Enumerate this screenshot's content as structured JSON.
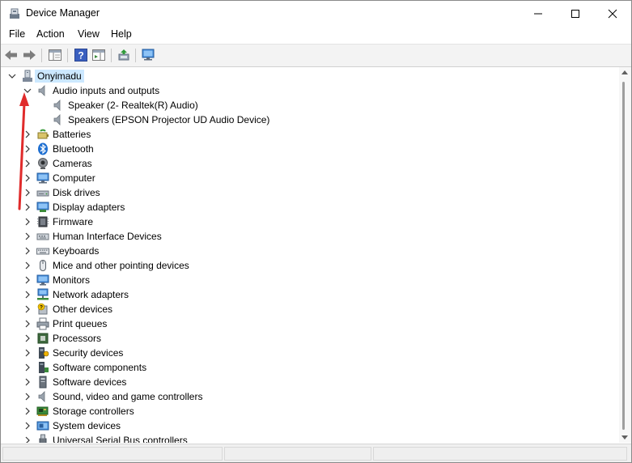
{
  "window": {
    "title": "Device Manager",
    "controls": {
      "minimize": "minimize",
      "maximize": "maximize",
      "close": "close"
    }
  },
  "menu": {
    "items": [
      "File",
      "Action",
      "View",
      "Help"
    ]
  },
  "toolbar": {
    "buttons": [
      "back-icon",
      "forward-icon",
      "properties-pane-icon",
      "help-icon",
      "action-pane-icon",
      "update-driver-icon",
      "scan-hardware-icon"
    ]
  },
  "tree": {
    "root": "Onyimadu",
    "categories": [
      {
        "label": "Audio inputs and outputs",
        "icon": "speaker-icon",
        "expanded": true,
        "children": [
          "Speaker (2- Realtek(R) Audio)",
          "Speakers (EPSON Projector UD Audio Device)"
        ]
      },
      {
        "label": "Batteries",
        "icon": "battery-icon"
      },
      {
        "label": "Bluetooth",
        "icon": "bluetooth-icon"
      },
      {
        "label": "Cameras",
        "icon": "camera-icon"
      },
      {
        "label": "Computer",
        "icon": "computer-icon"
      },
      {
        "label": "Disk drives",
        "icon": "disk-drive-icon"
      },
      {
        "label": "Display adapters",
        "icon": "display-adapter-icon"
      },
      {
        "label": "Firmware",
        "icon": "firmware-icon"
      },
      {
        "label": "Human Interface Devices",
        "icon": "hid-icon"
      },
      {
        "label": "Keyboards",
        "icon": "keyboard-icon"
      },
      {
        "label": "Mice and other pointing devices",
        "icon": "mouse-icon"
      },
      {
        "label": "Monitors",
        "icon": "monitor-icon"
      },
      {
        "label": "Network adapters",
        "icon": "network-adapter-icon"
      },
      {
        "label": "Other devices",
        "icon": "other-devices-icon"
      },
      {
        "label": "Print queues",
        "icon": "printer-icon"
      },
      {
        "label": "Processors",
        "icon": "processor-icon"
      },
      {
        "label": "Security devices",
        "icon": "security-device-icon"
      },
      {
        "label": "Software components",
        "icon": "software-component-icon"
      },
      {
        "label": "Software devices",
        "icon": "software-device-icon"
      },
      {
        "label": "Sound, video and game controllers",
        "icon": "sound-controller-icon"
      },
      {
        "label": "Storage controllers",
        "icon": "storage-controller-icon"
      },
      {
        "label": "System devices",
        "icon": "system-device-icon"
      },
      {
        "label": "Universal Serial Bus controllers",
        "icon": "usb-icon"
      }
    ]
  },
  "annotation": {
    "arrow_color": "#e02b2b"
  },
  "colors": {
    "selection": "#cce8ff",
    "accent": "#0067c0"
  }
}
